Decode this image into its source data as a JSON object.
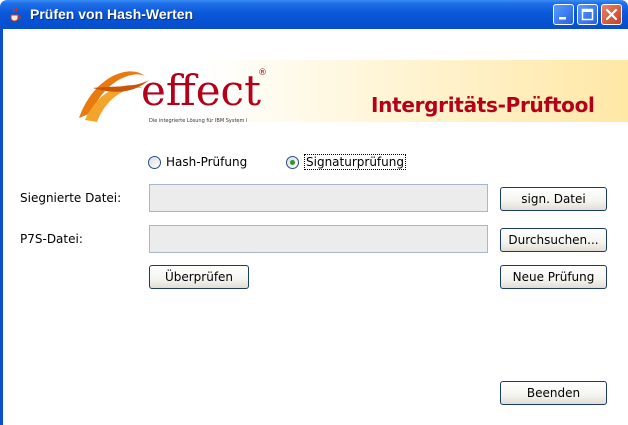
{
  "window": {
    "title": "Prüfen von Hash-Werten"
  },
  "banner": {
    "logo_text": "effect",
    "logo_reg": "®",
    "logo_tagline": "Die integrierte Lösung für IBM System i",
    "title": "Intergritäts-Prüftool",
    "accent_color": "#b5001a"
  },
  "mode": {
    "options": [
      {
        "label": "Hash-Prüfung",
        "selected": false
      },
      {
        "label": "Signaturprüfung",
        "selected": true
      }
    ]
  },
  "form": {
    "signed_file_label": "Siegnierte Datei:",
    "signed_file_value": "",
    "p7s_label": "P7S-Datei:",
    "p7s_value": ""
  },
  "buttons": {
    "sign_file": "sign. Datei",
    "browse": "Durchsuchen...",
    "verify": "Überprüfen",
    "new_check": "Neue Prüfung",
    "exit": "Beenden"
  }
}
